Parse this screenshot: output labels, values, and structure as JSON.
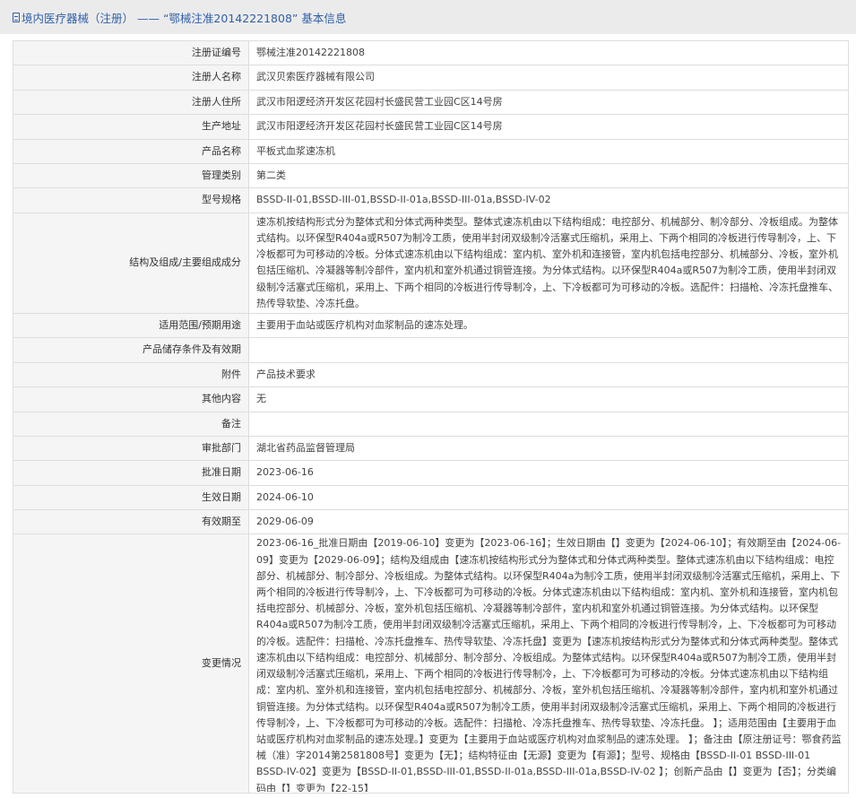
{
  "header": {
    "title": "境内医疗器械（注册） —— “鄂械注准20142221808” 基本信息"
  },
  "rows": [
    {
      "label": "注册证编号",
      "value": "鄂械注准20142221808"
    },
    {
      "label": "注册人名称",
      "value": "武汉贝索医疗器械有限公司"
    },
    {
      "label": "注册人住所",
      "value": "武汉市阳逻经济开发区花园村长盛民营工业园C区14号房"
    },
    {
      "label": "生产地址",
      "value": "武汉市阳逻经济开发区花园村长盛民营工业园C区14号房"
    },
    {
      "label": "产品名称",
      "value": "平板式血浆速冻机"
    },
    {
      "label": "管理类别",
      "value": "第二类"
    },
    {
      "label": "型号规格",
      "value": "BSSD-II-01,BSSD-III-01,BSSD-II-01a,BSSD-III-01a,BSSD-IV-02"
    },
    {
      "label": "结构及组成/主要组成成分",
      "value": "速冻机按结构形式分为整体式和分体式两种类型。整体式速冻机由以下结构组成：电控部分、机械部分、制冷部分、冷板组成。为整体式结构。以环保型R404a或R507为制冷工质，使用半封闭双级制冷活塞式压缩机，采用上、下两个相同的冷板进行传导制冷，上、下冷板都可为可移动的冷板。分体式速冻机由以下结构组成：室内机、室外机和连接管，室内机包括电控部分、机械部分、冷板，室外机包括压缩机、冷凝器等制冷部件，室内机和室外机通过铜管连接。为分体式结构。以环保型R404a或R507为制冷工质，使用半封闭双级制冷活塞式压缩机，采用上、下两个相同的冷板进行传导制冷，上、下冷板都可为可移动的冷板。选配件：扫描枪、冷冻托盘推车、热传导软垫、冷冻托盘。"
    },
    {
      "label": "适用范围/预期用途",
      "value": "主要用于血站或医疗机构对血浆制品的速冻处理。"
    },
    {
      "label": "产品储存条件及有效期",
      "value": ""
    },
    {
      "label": "附件",
      "value": "产品技术要求"
    },
    {
      "label": "其他内容",
      "value": "无"
    },
    {
      "label": "备注",
      "value": ""
    },
    {
      "label": "审批部门",
      "value": "湖北省药品监督管理局"
    },
    {
      "label": "批准日期",
      "value": "2023-06-16"
    },
    {
      "label": "生效日期",
      "value": "2024-06-10"
    },
    {
      "label": "有效期至",
      "value": "2029-06-09"
    },
    {
      "label": "变更情况",
      "value": "2023-06-16_批准日期由【2019-06-10】变更为【2023-06-16】；生效日期由【】变更为【2024-06-10】；有效期至由【2024-06-09】变更为【2029-06-09】；结构及组成由【速冻机按结构形式分为整体式和分体式两种类型。整体式速冻机由以下结构组成：电控部分、机械部分、制冷部分、冷板组成。为整体式结构。以环保型R404a为制冷工质，使用半封闭双级制冷活塞式压缩机，采用上、下两个相同的冷板进行传导制冷，上、下冷板都可为可移动的冷板。分体式速冻机由以下结构组成：室内机、室外机和连接管，室内机包括电控部分、机械部分、冷板，室外机包括压缩机、冷凝器等制冷部件，室内机和室外机通过铜管连接。为分体式结构。以环保型R404a或R507为制冷工质，使用半封闭双级制冷活塞式压缩机，采用上、下两个相同的冷板进行传导制冷，上、下冷板都可为可移动的冷板。选配件：扫描枪、冷冻托盘推车、热传导软垫、冷冻托盘】变更为【速冻机按结构形式分为整体式和分体式两种类型。整体式速冻机由以下结构组成：电控部分、机械部分、制冷部分、冷板组成。为整体式结构。以环保型R404a或R507为制冷工质，使用半封闭双级制冷活塞式压缩机，采用上、下两个相同的冷板进行传导制冷，上、下冷板都可为可移动的冷板。分体式速冻机由以下结构组成：室内机、室外机和连接管，室内机包括电控部分、机械部分、冷板，室外机包括压缩机、冷凝器等制冷部件，室内机和室外机通过铜管连接。为分体式结构。以环保型R404a或R507为制冷工质，使用半封闭双级制冷活塞式压缩机，采用上、下两个相同的冷板进行传导制冷，上、下冷板都可为可移动的冷板。选配件：扫描枪、冷冻托盘推车、热传导软垫、冷冻托盘。\n】；适用范围由【主要用于血站或医疗机构对血浆制品的速冻处理。】变更为【主要用于血站或医疗机构对血浆制品的速冻处理。\n】；备注由【原注册证号：鄂食药监械（准）字2014第2581808号】变更为【无】；结构特征由【无源】变更为【有源】；型号、规格由【BSSD-II-01 BSSD-III-01 BSSD-IV-02】变更为【BSSD-II-01,BSSD-III-01,BSSD-II-01a,BSSD-III-01a,BSSD-IV-02\n】；创新产品由【】变更为【否】；分类编码由【】变更为【22-15】"
    }
  ]
}
